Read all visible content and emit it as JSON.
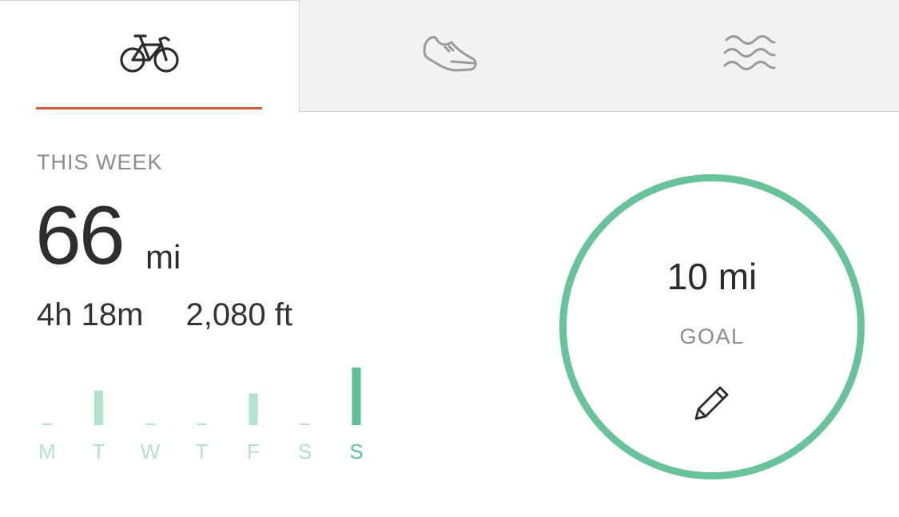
{
  "tabs": [
    {
      "name": "bike-icon",
      "active": true
    },
    {
      "name": "shoe-icon",
      "active": false
    },
    {
      "name": "water-icon",
      "active": false
    }
  ],
  "accent_color": "#d35d3a",
  "goal_color": "#68c39b",
  "summary": {
    "period_label": "THIS WEEK",
    "distance_value": "66",
    "distance_unit": "mi",
    "time": "4h 18m",
    "elevation": "2,080 ft"
  },
  "chart_data": {
    "type": "bar",
    "categories": [
      "M",
      "T",
      "W",
      "T",
      "F",
      "S",
      "S"
    ],
    "values": [
      0,
      0.6,
      0,
      0,
      0.55,
      0,
      1.0
    ],
    "highlight_index": 6,
    "ylim": [
      0,
      1
    ]
  },
  "goal": {
    "value": "10 mi",
    "label": "GOAL",
    "edit_icon": "pencil-icon"
  }
}
